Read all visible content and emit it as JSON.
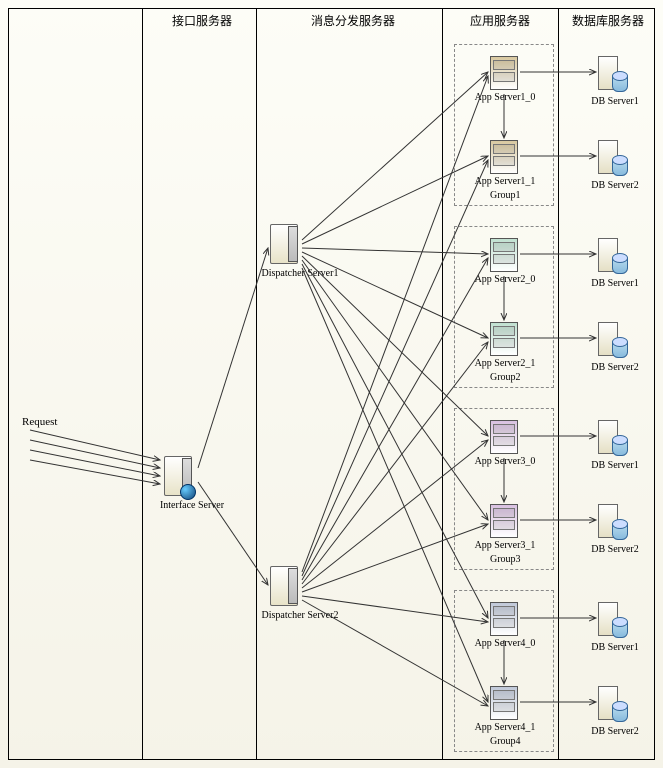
{
  "lanes": {
    "interface": "接口服务器",
    "dispatcher": "消息分发服务器",
    "app": "应用服务器",
    "db": "数据库服务器"
  },
  "request_label": "Request",
  "interface_server": "Interface Server",
  "dispatchers": [
    "Dispatcher Server1",
    "Dispatcher Server2"
  ],
  "groups": [
    {
      "name": "Group1",
      "servers": [
        "App Server1_0",
        "App Server1_1"
      ],
      "db": [
        "DB Server1",
        "DB Server2"
      ]
    },
    {
      "name": "Group2",
      "servers": [
        "App Server2_0",
        "App Server2_1"
      ],
      "db": [
        "DB Server1",
        "DB Server2"
      ]
    },
    {
      "name": "Group3",
      "servers": [
        "App Server3_0",
        "App Server3_1"
      ],
      "db": [
        "DB Server1",
        "DB Server2"
      ]
    },
    {
      "name": "Group4",
      "servers": [
        "App Server4_0",
        "App Server4_1"
      ],
      "db": [
        "DB Server1",
        "DB Server2"
      ]
    }
  ],
  "colors": {
    "group1_rack": "#d8c8a0",
    "group2_rack": "#c0e0d0",
    "group3_rack": "#d8c0e0",
    "group4_rack": "#c0c8d8"
  }
}
